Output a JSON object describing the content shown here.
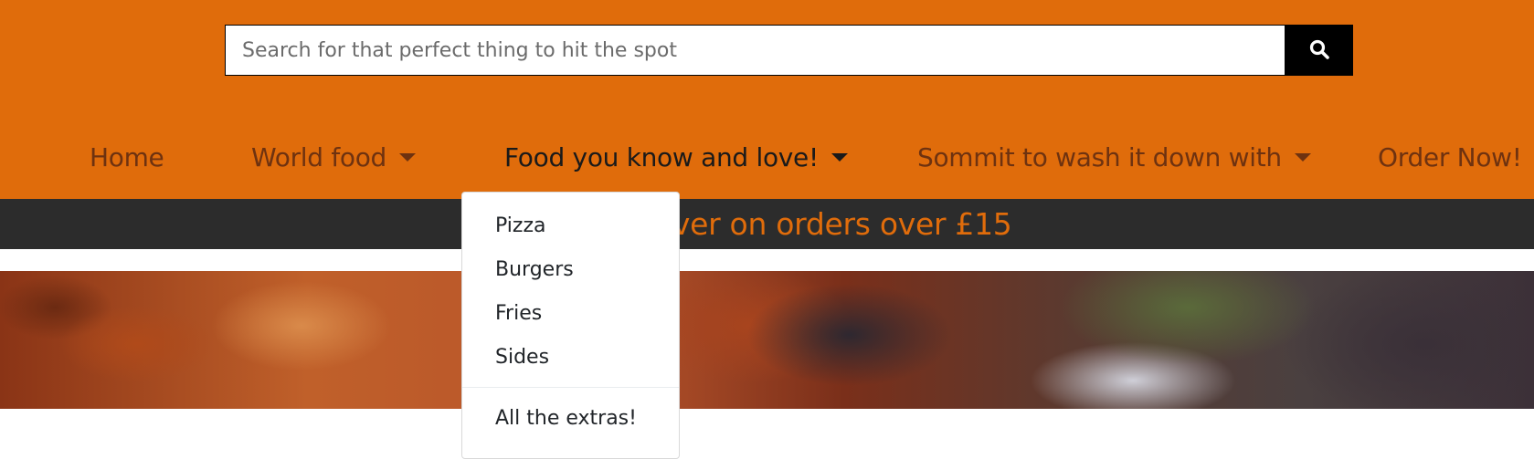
{
  "search": {
    "placeholder": "Search for that perfect thing to hit the spot",
    "button_icon": "search-icon"
  },
  "nav": {
    "items": [
      {
        "label": "Home",
        "has_dropdown": false
      },
      {
        "label": "World food",
        "has_dropdown": true
      },
      {
        "label": "Food you know and love!",
        "has_dropdown": true,
        "active": true
      },
      {
        "label": "Sommit to wash it down with",
        "has_dropdown": true
      },
      {
        "label": "Order Now!",
        "has_dropdown": false
      }
    ]
  },
  "banner": {
    "visible_text": "iver on orders over £15"
  },
  "dropdown": {
    "items": [
      "Pizza",
      "Burgers",
      "Fries",
      "Sides"
    ],
    "extra_item": "All the extras!"
  },
  "colors": {
    "header_bg": "#e06c0b",
    "nav_text": "#6e3210",
    "banner_bg": "#2c2c2c",
    "banner_text": "#e06c0b",
    "search_button_bg": "#000000"
  }
}
